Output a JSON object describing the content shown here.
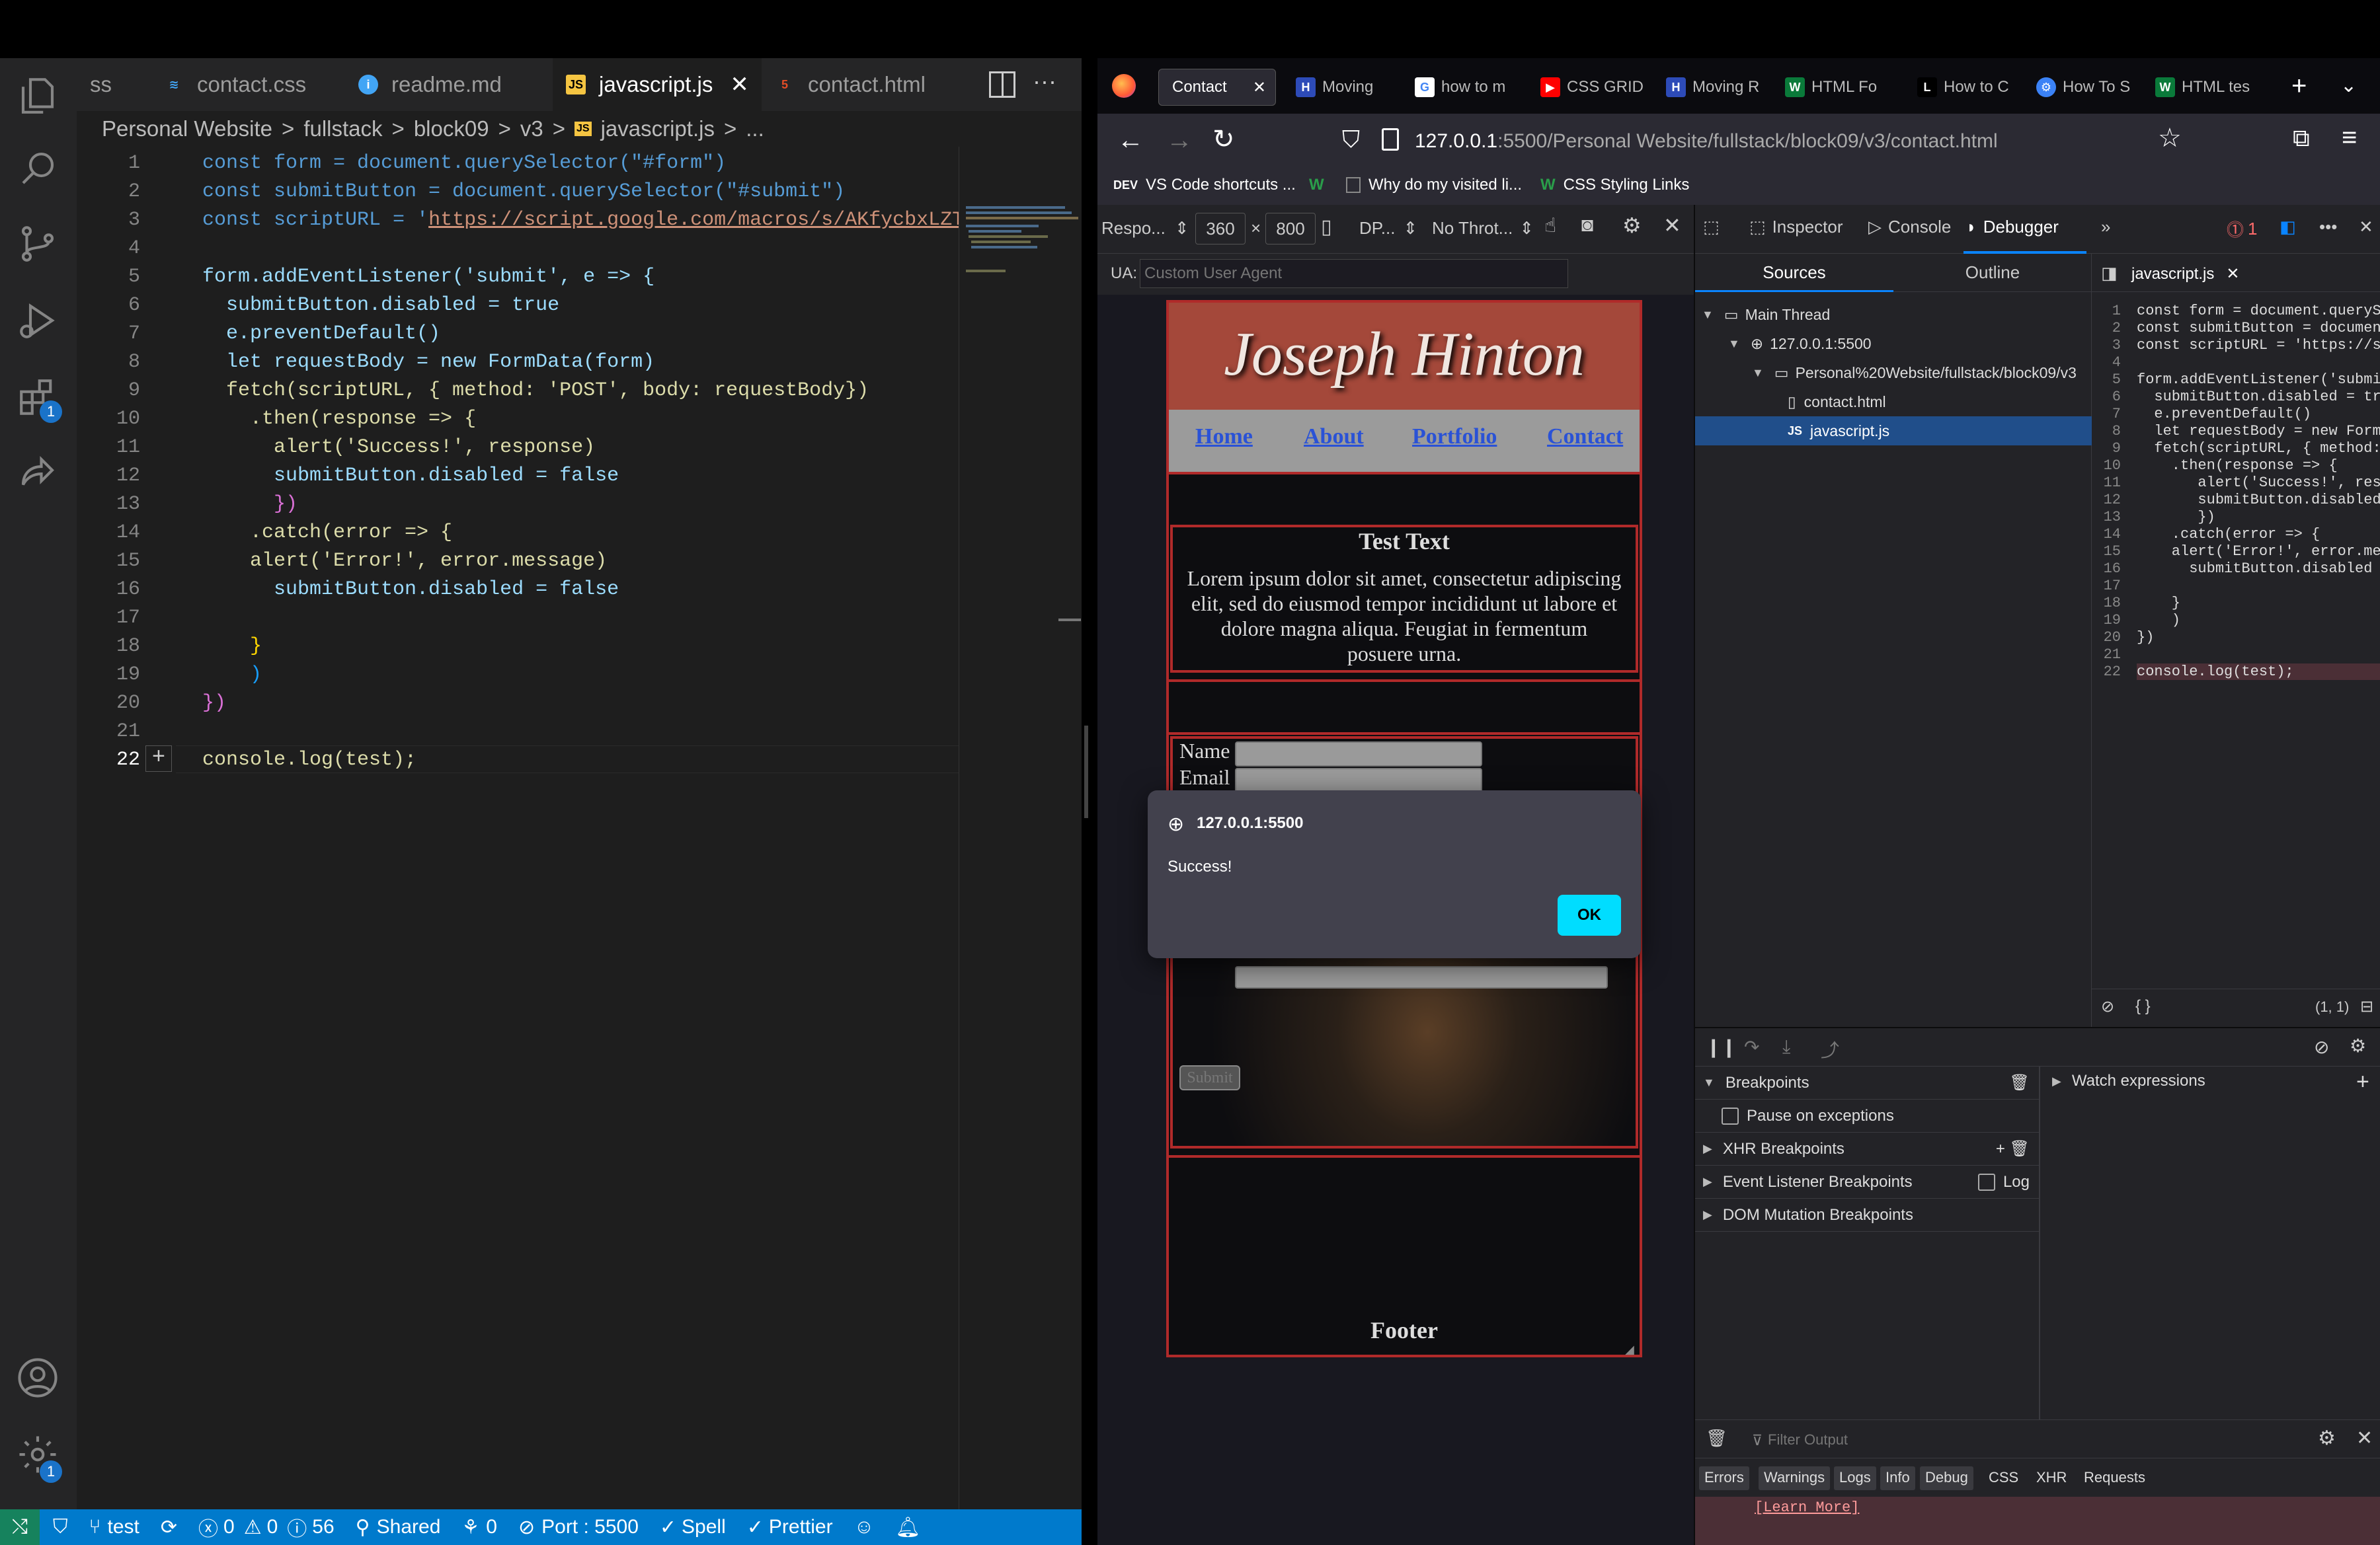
{
  "vscode": {
    "tabs": [
      {
        "label": "ss",
        "icon": ""
      },
      {
        "label": "contact.css",
        "icon": "css-icon"
      },
      {
        "label": "readme.md",
        "icon": "info-icon"
      },
      {
        "label": "javascript.js",
        "icon": "js-icon",
        "active": true
      },
      {
        "label": "contact.html",
        "icon": "html5-icon"
      }
    ],
    "breadcrumb": [
      "Personal Website",
      ">",
      "fullstack",
      ">",
      "block09",
      ">",
      "v3",
      ">",
      "JS",
      "javascript.js",
      ">",
      "..."
    ],
    "line_numbers": [
      "1",
      "2",
      "3",
      "4",
      "5",
      "6",
      "7",
      "8",
      "9",
      "10",
      "11",
      "12",
      "13",
      "14",
      "15",
      "16",
      "17",
      "18",
      "19",
      "20",
      "21",
      "22"
    ],
    "code": {
      "l1": "const form = document.querySelector(\"#form\")",
      "l2": "const submitButton = document.querySelector(\"#submit\")",
      "l3a": "const scriptURL = '",
      "l3b": "https://script.google.com/macros/s/AKfycbxLZTlg",
      "l5": "form.addEventListener('submit', e => {",
      "l6": "  submitButton.disabled = true",
      "l7": "  e.preventDefault()",
      "l8": "  let requestBody = new FormData(form)",
      "l9": "  fetch(scriptURL, { method: 'POST', body: requestBody})",
      "l10": "    .then(response => {",
      "l11": "      alert('Success!', response)",
      "l12": "      submitButton.disabled = false",
      "l13": "      })",
      "l14": "    .catch(error => {",
      "l15": "    alert('Error!', error.message)",
      "l16": "      submitButton.disabled = false",
      "l18": "    }",
      "l19": "    )",
      "l20": "})",
      "l22": "console.log(test);"
    },
    "status": {
      "branch": "test",
      "errors": "0",
      "warnings": "0",
      "info": "56",
      "shared": "Shared",
      "ports": "0",
      "port": "Port : 5500",
      "spell": "Spell",
      "prettier": "Prettier"
    },
    "badges": {
      "extensions": "1",
      "settings": "1"
    }
  },
  "firefox": {
    "tabs": [
      "Contact",
      "Moving",
      "how to m",
      "CSS GRID",
      "Moving R",
      "HTML Fo",
      "How to C",
      "How To S",
      "HTML tes"
    ],
    "url_host": "127.0.0.1",
    "url_rest": ":5500/Personal Website/fullstack/block09/v3/contact.html",
    "bookmarks": [
      "DEV",
      "VS Code shortcuts ...",
      "Why do my visited li...",
      "CSS Styling Links"
    ],
    "rdm": {
      "device": "Respo...",
      "width": "360",
      "height": "800",
      "dpr": "DP...",
      "throttle": "No Throt..."
    },
    "ua_label": "UA:",
    "ua_placeholder": "Custom User Agent",
    "page": {
      "title": "Joseph Hinton",
      "nav": [
        "Home",
        "About",
        "Portfolio",
        "Contact"
      ],
      "test_heading": "Test Text",
      "lorem": "Lorem ipsum dolor sit amet, consectetur adipiscing elit, sed do eiusmod tempor incididunt ut labore et dolore magna aliqua. Feugiat in fermentum posuere urna.",
      "name_label": "Name",
      "email_label": "Email",
      "submit_label": "Submit",
      "footer": "Footer"
    },
    "dialog": {
      "origin": "127.0.0.1:5500",
      "message": "Success!",
      "ok": "OK"
    },
    "devtools": {
      "tabs": [
        "Inspector",
        "Console",
        "Debugger"
      ],
      "error_count": "1",
      "sources_tab": "Sources",
      "outline_tab": "Outline",
      "tree": [
        "Main Thread",
        "127.0.0.1:5500",
        "Personal%20Website/fullstack/block09/v3",
        "contact.html",
        "javascript.js"
      ],
      "file_tab": "javascript.js",
      "code_lines": [
        {
          "n": "1",
          "t": "const form = document.queryS"
        },
        {
          "n": "2",
          "t": "const submitButton = documen"
        },
        {
          "n": "3",
          "t": "const scriptURL = 'https://s"
        },
        {
          "n": "4",
          "t": ""
        },
        {
          "n": "5",
          "t": "form.addEventListener('submi"
        },
        {
          "n": "6",
          "t": "  submitButton.disabled = tr"
        },
        {
          "n": "7",
          "t": "  e.preventDefault()"
        },
        {
          "n": "8",
          "t": "  let requestBody = new Form"
        },
        {
          "n": "9",
          "t": "  fetch(scriptURL, { method:"
        },
        {
          "n": "10",
          "t": "    .then(response => {"
        },
        {
          "n": "11",
          "t": "       alert('Success!', res"
        },
        {
          "n": "12",
          "t": "       submitButton.disabled"
        },
        {
          "n": "13",
          "t": "       })"
        },
        {
          "n": "14",
          "t": "    .catch(error => {"
        },
        {
          "n": "15",
          "t": "    alert('Error!', error.me"
        },
        {
          "n": "16",
          "t": "      submitButton.disabled"
        },
        {
          "n": "17",
          "t": ""
        },
        {
          "n": "18",
          "t": "    }"
        },
        {
          "n": "19",
          "t": "    )"
        },
        {
          "n": "20",
          "t": "})"
        },
        {
          "n": "21",
          "t": ""
        },
        {
          "n": "22",
          "t": "console.log(test);"
        }
      ],
      "cursor_pos": "(1, 1)",
      "breakpoints": "Breakpoints",
      "pause_exceptions": "Pause on exceptions",
      "xhr_breakpoints": "XHR Breakpoints",
      "event_breakpoints": "Event Listener Breakpoints",
      "log_label": "Log",
      "dom_breakpoints": "DOM Mutation Breakpoints",
      "watch": "Watch expressions",
      "filter_placeholder": "Filter Output",
      "console_filters": [
        "Errors",
        "Warnings",
        "Logs",
        "Info",
        "Debug"
      ],
      "console_extra": [
        "CSS",
        "XHR",
        "Requests"
      ],
      "learn_more": "[Learn More]"
    }
  }
}
